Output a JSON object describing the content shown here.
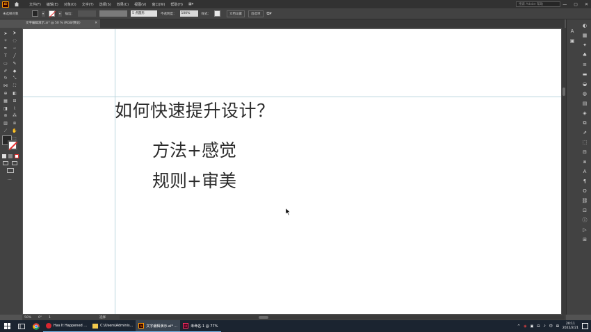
{
  "app": {
    "logo_text": "Ai",
    "menus": [
      "文件(F)",
      "编辑(E)",
      "对象(O)",
      "文字(T)",
      "选择(S)",
      "效果(C)",
      "视图(V)",
      "窗口(W)",
      "帮助(H)"
    ],
    "layout_label": "▦▾",
    "search_placeholder": "搜索 Adobe 帮助",
    "win_controls": [
      "—",
      "▢",
      "✕"
    ]
  },
  "controlbar": {
    "selection_label": "未选择对象",
    "stroke_label": "描边：",
    "brush_value": "5 点圆形",
    "opacity_label": "不透明度：",
    "opacity_value": "100%",
    "style_label": "样式：",
    "doc_setup_button": "文档设置",
    "prefs_button": "首选项"
  },
  "document": {
    "tab_title": "文字编辑演示.ai* @ 50 % (RGB/预览)",
    "tab_close": "✕"
  },
  "artboard": {
    "heading": "如何快速提升设计？",
    "line1": "方法+感觉",
    "line2": "规则+审美"
  },
  "status": {
    "zoom": "50%",
    "angle": "0°",
    "page": "1",
    "mode": "选择"
  },
  "taskbar": {
    "apps": [
      {
        "label": "Has It Happened ...",
        "icon": "netease-music-icon",
        "color": "#d8262f"
      },
      {
        "label": "C:\\Users\\Adminis...",
        "icon": "folder-icon",
        "color": "#f2c94c"
      },
      {
        "label": "文字编辑演示.ai* ...",
        "icon": "illustrator-icon",
        "color": "#ff9a00"
      },
      {
        "label": "未命名-1 @ 77%",
        "icon": "indesign-icon",
        "color": "#ff3366"
      }
    ],
    "time": "20:11",
    "date": "2022/2/21",
    "ime": "中"
  }
}
